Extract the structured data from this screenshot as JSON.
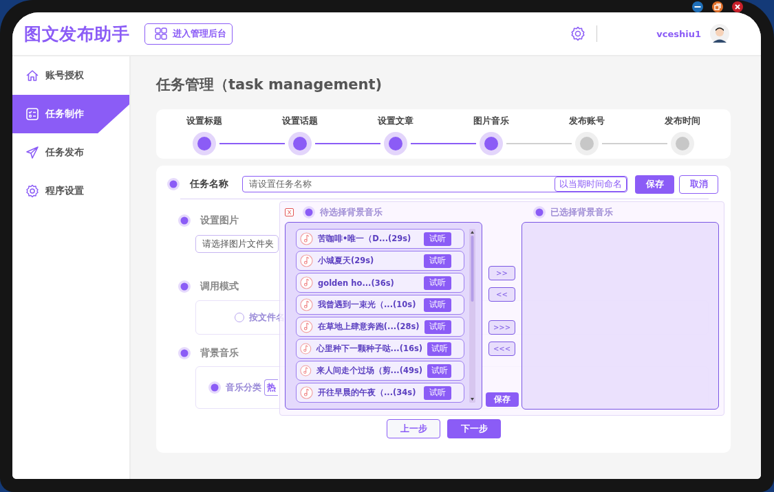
{
  "app": {
    "title": "图文发布助手",
    "admin_button": "进入管理后台",
    "username": "vceshiu1"
  },
  "sidebar": {
    "items": [
      {
        "label": "账号授权",
        "selected": false
      },
      {
        "label": "任务制作",
        "selected": true
      },
      {
        "label": "任务发布",
        "selected": false
      },
      {
        "label": "程序设置",
        "selected": false
      }
    ]
  },
  "page_title": "任务管理（task management)",
  "steps": [
    {
      "label": "设置标题",
      "done": true
    },
    {
      "label": "设置话题",
      "done": true
    },
    {
      "label": "设置文章",
      "done": true
    },
    {
      "label": "图片音乐",
      "done": true
    },
    {
      "label": "发布账号",
      "done": false
    },
    {
      "label": "发布时间",
      "done": false
    }
  ],
  "task_name": {
    "label": "任务名称",
    "placeholder": "请设置任务名称",
    "name_button": "以当期时间命名",
    "save": "保存",
    "cancel": "取消"
  },
  "image_section": {
    "label": "设置图片",
    "folder_placeholder": "请选择图片文件夹"
  },
  "mode_section": {
    "label": "调用模式",
    "order_option": {
      "label": "按文件名",
      "selected": false
    }
  },
  "music_section": {
    "label": "背景音乐",
    "category_label": "音乐分类",
    "category_value": "热"
  },
  "music_dialog": {
    "close_label": "X",
    "available_title": "待选择背景音乐",
    "selected_title": "已选择背景音乐",
    "tracks": [
      {
        "title": "苦咖啡•唯一（D...(29s)",
        "action": "试听"
      },
      {
        "title": "小城夏天(29s)",
        "action": "试听"
      },
      {
        "title": "golden ho...(36s)",
        "action": "试听"
      },
      {
        "title": "我曾遇到一束光（...(10s)",
        "action": "试听"
      },
      {
        "title": "在草地上肆意奔跑(...(28s)",
        "action": "试听"
      },
      {
        "title": "心里种下一颗种子哒...(16s)",
        "action": "试听"
      },
      {
        "title": "来人间走个过场（剪...(49s)",
        "action": "试听"
      },
      {
        "title": "开往早晨的午夜（...(34s)",
        "action": "试听"
      }
    ],
    "move_buttons": [
      ">>",
      "<<",
      ">>>",
      "<<<"
    ],
    "save": "保存"
  },
  "nav": {
    "prev": "上一步",
    "next": "下一步"
  }
}
